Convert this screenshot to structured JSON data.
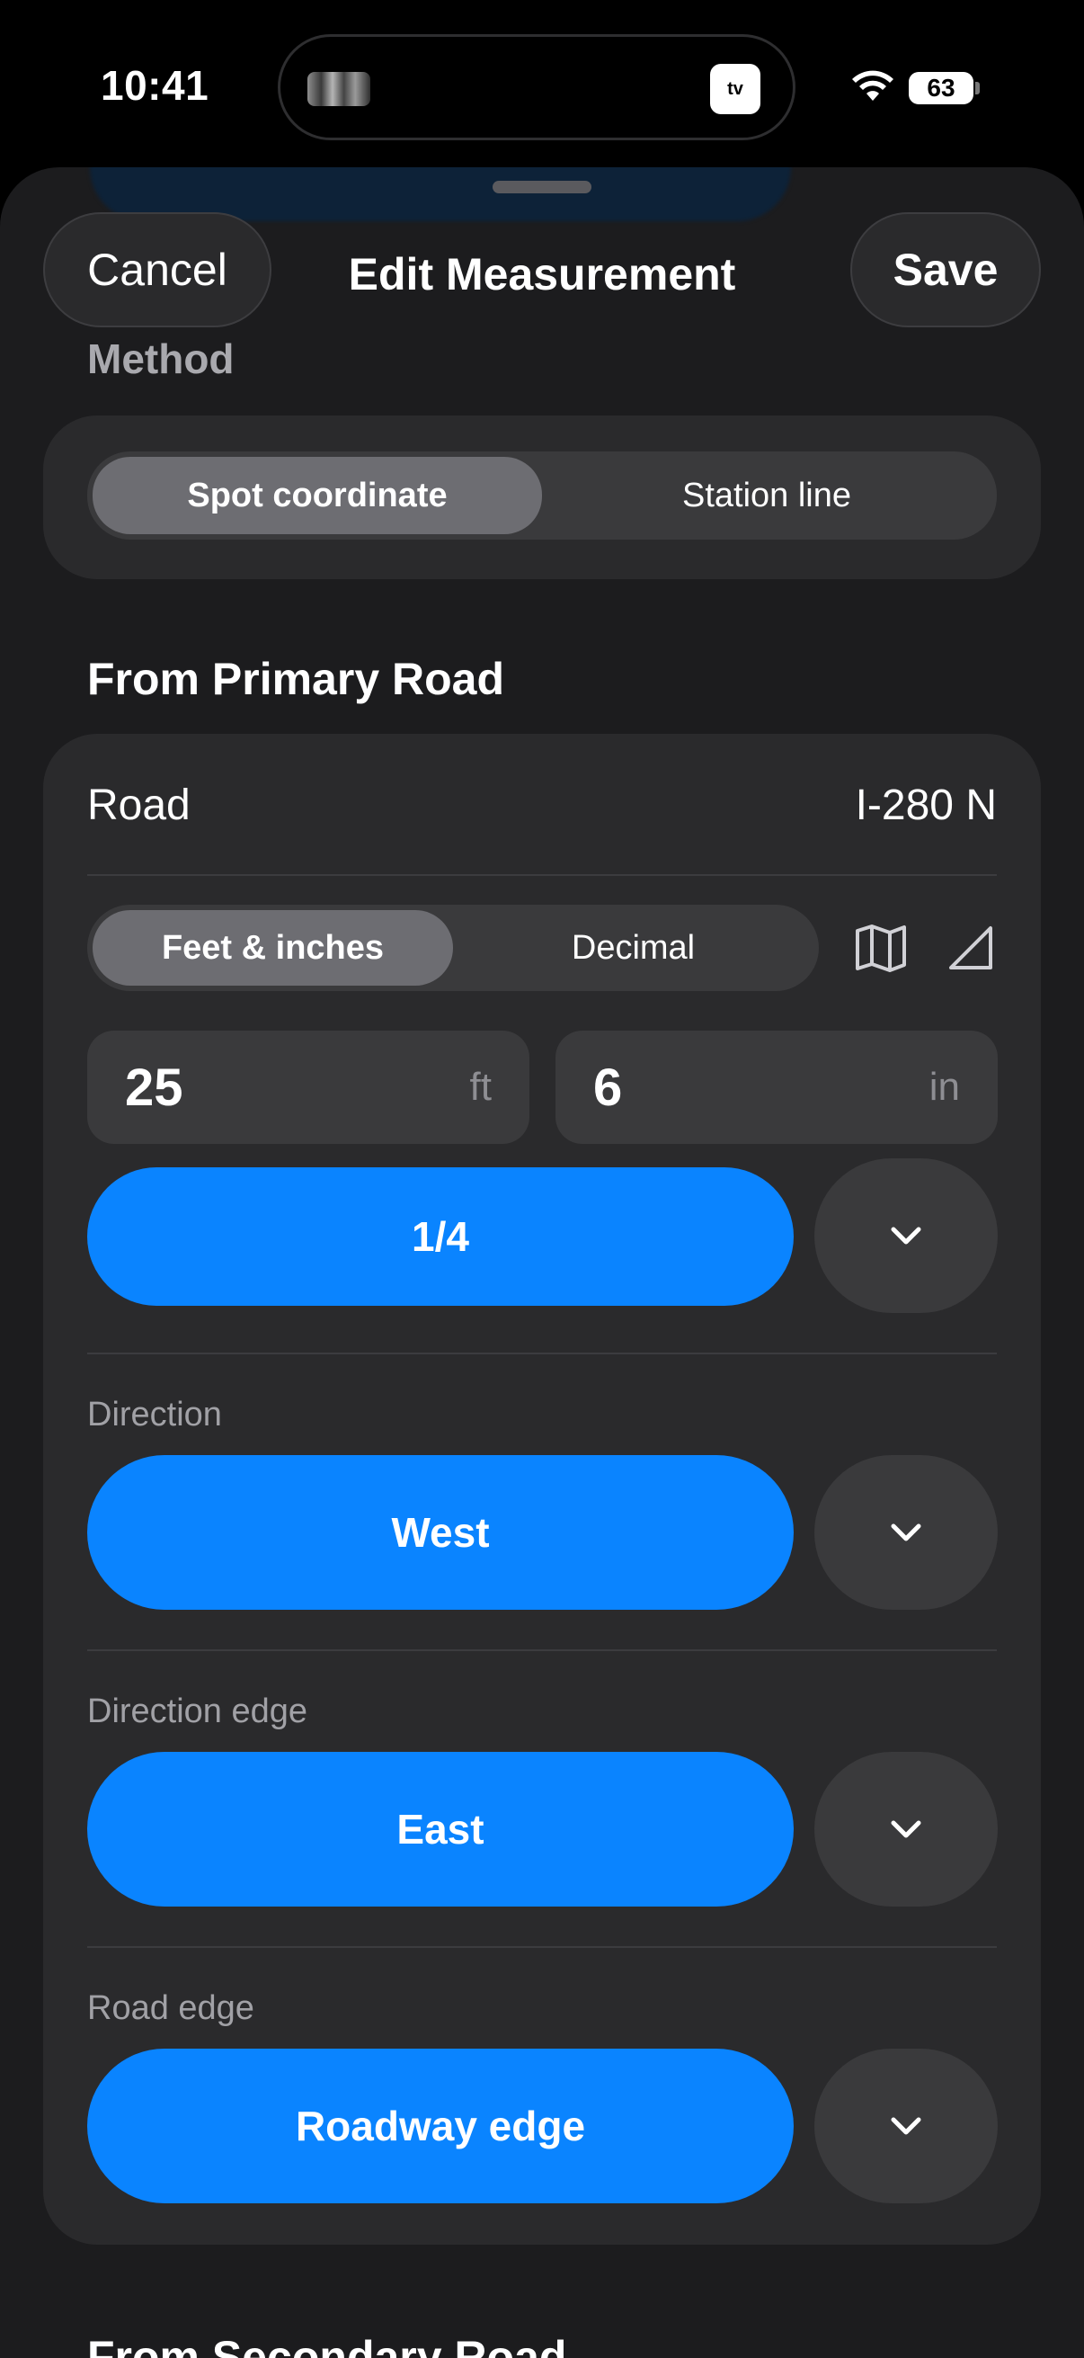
{
  "status_bar": {
    "time": "10:41",
    "battery": "63",
    "island_app_label": "tv",
    "icons": [
      "wifi-icon",
      "battery-icon",
      "apple-tv-icon"
    ]
  },
  "sheet": {
    "cancel_label": "Cancel",
    "title": "Edit Measurement",
    "save_label": "Save"
  },
  "method": {
    "header": "Method",
    "options": [
      "Spot coordinate",
      "Station line"
    ],
    "selected": "Spot coordinate"
  },
  "primary_road": {
    "header": "From Primary Road",
    "road_label": "Road",
    "road_value": "I-280 N",
    "unit_options": [
      "Feet & inches",
      "Decimal"
    ],
    "unit_selected": "Feet & inches",
    "feet_value": "25",
    "feet_unit": "ft",
    "inches_value": "6",
    "inches_unit": "in",
    "fraction_value": "1/4",
    "direction_label": "Direction",
    "direction_value": "West",
    "direction_edge_label": "Direction edge",
    "direction_edge_value": "East",
    "road_edge_label": "Road edge",
    "road_edge_value": "Roadway edge",
    "icons": [
      "map-icon",
      "triangle-icon",
      "chevron-down-icon"
    ]
  },
  "secondary_road": {
    "header": "From Secondary Road"
  },
  "colors": {
    "accent": "#0a84ff",
    "background": "#1c1c1e",
    "card": "#2a2a2c"
  }
}
